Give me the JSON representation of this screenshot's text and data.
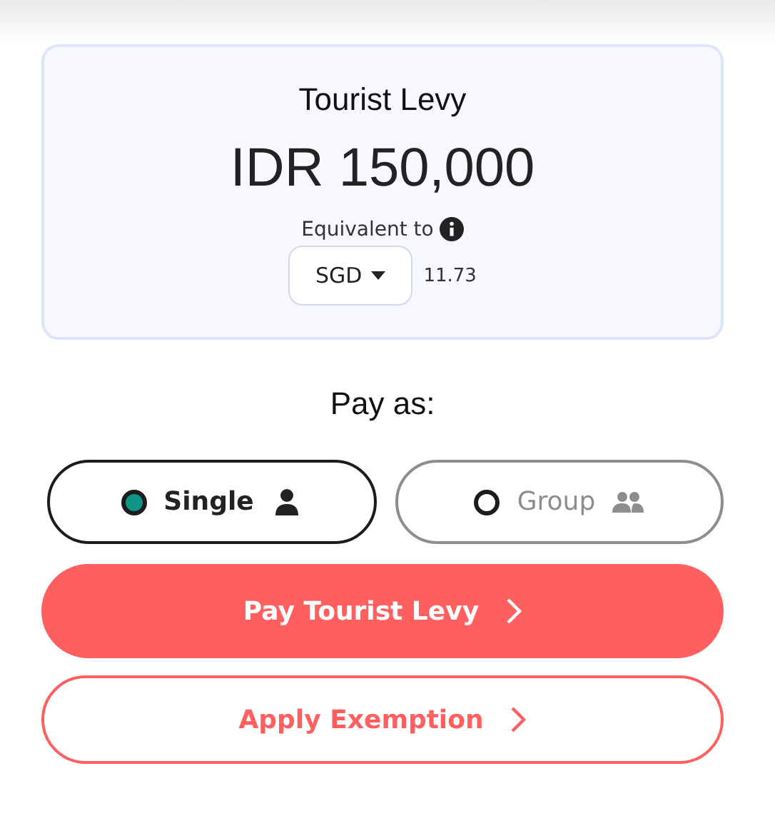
{
  "levy": {
    "title": "Tourist Levy",
    "amount": "IDR 150,000",
    "equivalent_label": "Equivalent to",
    "currency": "SGD",
    "converted": "11.73"
  },
  "pay_as": {
    "label": "Pay as:",
    "options": [
      {
        "label": "Single",
        "kind": "single",
        "selected": true
      },
      {
        "label": "Group",
        "kind": "group",
        "selected": false
      }
    ]
  },
  "actions": [
    {
      "label": "Pay Tourist Levy",
      "kind": "primary"
    },
    {
      "label": "Apply Exemption",
      "kind": "secondary"
    }
  ]
}
